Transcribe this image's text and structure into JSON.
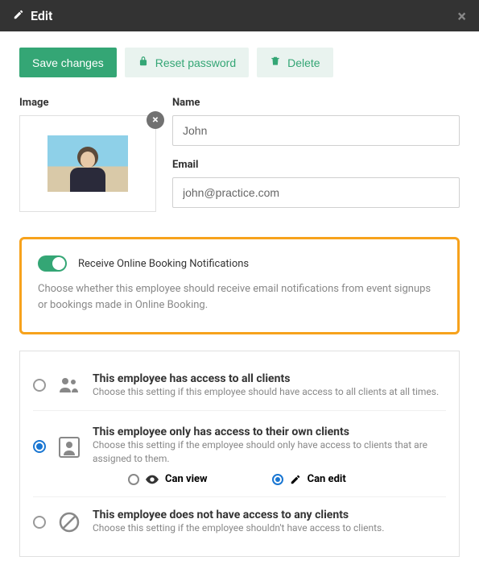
{
  "header": {
    "title": "Edit"
  },
  "toolbar": {
    "save_label": "Save changes",
    "reset_label": "Reset password",
    "delete_label": "Delete"
  },
  "form": {
    "image_label": "Image",
    "name_label": "Name",
    "name_value": "John",
    "email_label": "Email",
    "email_value": "john@practice.com"
  },
  "notifications": {
    "toggle_on": true,
    "label": "Receive Online Booking Notifications",
    "hint": "Choose whether this employee should receive email notifications from event signups or bookings made in Online Booking."
  },
  "access": {
    "options": [
      {
        "title": "This employee has access to all clients",
        "sub": "Choose this setting if this employee should have access to all clients at all times.",
        "checked": false
      },
      {
        "title": "This employee only has access to their own clients",
        "sub": "Choose this setting if the employee should only have access to clients that are assigned to them.",
        "checked": true,
        "permissions": {
          "view_label": "Can view",
          "edit_label": "Can edit",
          "selected": "edit"
        }
      },
      {
        "title": "This employee does not have access to any clients",
        "sub": "Choose this setting if the employee shouldn't have access to clients.",
        "checked": false
      }
    ]
  }
}
